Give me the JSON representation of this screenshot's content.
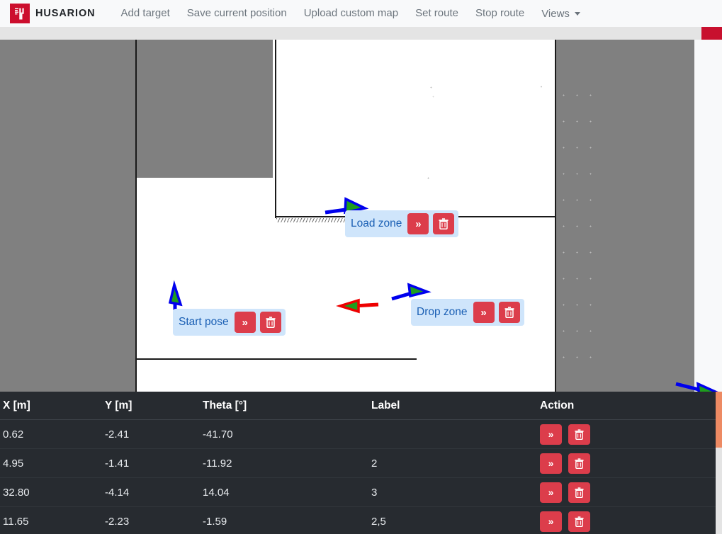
{
  "brand": {
    "name": "HUSARION",
    "logo_icon": "husarion-logo-icon",
    "logo_color": "#cc0e2d"
  },
  "navbar": {
    "items": [
      {
        "label": "Add target"
      },
      {
        "label": "Save current position"
      },
      {
        "label": "Upload custom map"
      },
      {
        "label": "Set route"
      },
      {
        "label": "Stop route"
      }
    ],
    "dropdown": {
      "label": "Views",
      "icon": "chevron-down-icon"
    }
  },
  "map": {
    "markers": [
      {
        "name": "load-zone",
        "label": "Load zone",
        "arrow_color": "#0000ee",
        "fill_color": "#1e9e1e"
      },
      {
        "name": "start-pose",
        "label": "Start pose",
        "arrow_color": "#0000ee",
        "fill_color": "#1e9e1e"
      },
      {
        "name": "drop-zone",
        "label": "Drop zone",
        "arrow_color": "#0000ee",
        "fill_color": "#1e9e1e"
      },
      {
        "name": "current-goal",
        "label": "",
        "arrow_color": "#ee0000",
        "fill_color": "#1e9e1e"
      },
      {
        "name": "robot-pose",
        "label": "",
        "arrow_color": "#0000ee",
        "fill_color": "#1e9e1e"
      }
    ],
    "chip_buttons": {
      "goto_icon": "double-chevron-right-icon",
      "goto_glyph": "»",
      "delete_icon": "trash-icon"
    },
    "colors": {
      "unknown": "#808080",
      "free": "#ffffff",
      "wall": "#1a1a1a",
      "chip_bg": "#cfe5fb",
      "chip_text": "#1a5fb4",
      "button": "#dc3d4b"
    }
  },
  "table": {
    "headers": [
      "X [m]",
      "Y [m]",
      "Theta [°]",
      "Label",
      "Action"
    ],
    "rows": [
      {
        "x": "0.62",
        "y": "-2.41",
        "theta": "-41.70",
        "label": ""
      },
      {
        "x": "4.95",
        "y": "-1.41",
        "theta": "-11.92",
        "label": "2"
      },
      {
        "x": "32.80",
        "y": "-4.14",
        "theta": "14.04",
        "label": "3"
      },
      {
        "x": "11.65",
        "y": "-2.23",
        "theta": "-1.59",
        "label": "2,5"
      }
    ],
    "action": {
      "goto_glyph": "»",
      "goto_icon": "double-chevron-right-icon",
      "delete_icon": "trash-icon"
    },
    "bg_color": "#272b30"
  },
  "scrollbar": {
    "name": "vertical-scrollbar",
    "track_color": "#e4e4e4",
    "thumb_color": "#ed8a63"
  },
  "subband": {
    "bg_color": "#e4e4e4",
    "accent_color": "#c8102e"
  }
}
